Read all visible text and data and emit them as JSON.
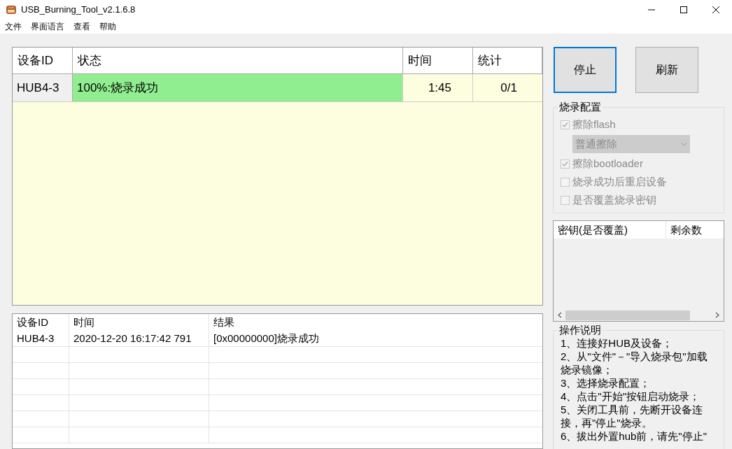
{
  "window": {
    "title": "USB_Burning_Tool_v2.1.6.8"
  },
  "menu": [
    "文件",
    "界面语言",
    "查看",
    "帮助"
  ],
  "device_table": {
    "columns": [
      "设备ID",
      "状态",
      "时间",
      "统计"
    ],
    "rows": [
      {
        "device_id": "HUB4-3",
        "status": "100%:烧录成功",
        "level": 1,
        "time": "1:45",
        "count": "0/1"
      }
    ]
  },
  "log_table": {
    "columns": [
      "设备ID",
      "时间",
      "结果"
    ],
    "rows": [
      {
        "device_id": "HUB4-3",
        "time": "2020-12-20 16:17:42 791",
        "result": "[0x00000000]烧录成功"
      }
    ]
  },
  "buttons": [
    {
      "label": "停止",
      "selected": true
    },
    {
      "label": "刷新",
      "selected": false
    }
  ],
  "burn_config": {
    "title": "烧录配置",
    "items": [
      {
        "kind": "checkbox",
        "label": "擦除flash",
        "checked": true,
        "disabled": true
      },
      {
        "kind": "dropdown",
        "value": "普通擦除",
        "disabled": true
      },
      {
        "kind": "checkbox",
        "label": "擦除bootloader",
        "checked": true,
        "disabled": true
      },
      {
        "kind": "checkbox",
        "label": "烧录成功后重启设备",
        "checked": false,
        "disabled": true
      },
      {
        "kind": "checkbox",
        "label": "是否覆盖烧录密钥",
        "checked": false,
        "disabled": true
      }
    ]
  },
  "key_table": {
    "columns": [
      "密钥(是否覆盖)",
      "剩余数"
    ]
  },
  "instructions": {
    "title": "操作说明",
    "lines": [
      "1、连接好HUB及设备；",
      "2、从\"文件\"－\"导入烧录包\"加载烧录镜像；",
      "3、选择烧录配置；",
      "4、点击\"开始\"按钮启动烧录；",
      "5、关闭工具前，先断开设备连接，再\"停止\"烧录。",
      "6、拔出外置hub前，请先\"停止\""
    ]
  }
}
